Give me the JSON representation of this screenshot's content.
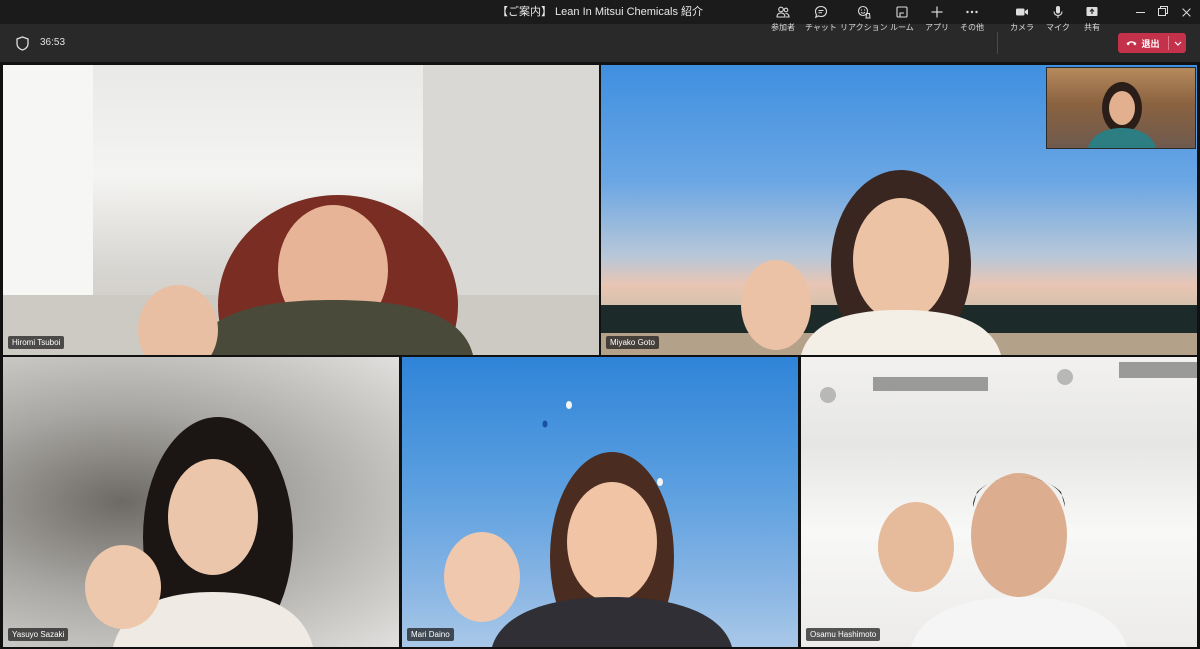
{
  "window": {
    "title": "【ご案内】 Lean In Mitsui Chemicals 紹介"
  },
  "toolbar": {
    "timer": "36:53",
    "buttons": [
      {
        "icon": "people-icon",
        "label": "参加者"
      },
      {
        "icon": "chat-icon",
        "label": "チャット"
      },
      {
        "icon": "reaction-icon",
        "label": "リアクション"
      },
      {
        "icon": "rooms-icon",
        "label": "ルーム"
      },
      {
        "icon": "plus-icon",
        "label": "アプリ"
      },
      {
        "icon": "more-icon",
        "label": "その他"
      },
      {
        "icon": "camera-icon",
        "label": "カメラ"
      },
      {
        "icon": "mic-icon",
        "label": "マイク"
      },
      {
        "icon": "share-icon",
        "label": "共有"
      }
    ],
    "leave_label": "退出",
    "leave_color": "#c4314b"
  },
  "participants": [
    {
      "name": "Hiromi Tsuboi"
    },
    {
      "name": "Miyako Goto"
    },
    {
      "name": "Yasuyo Sazaki"
    },
    {
      "name": "Mari Daino"
    },
    {
      "name": "Osamu Hashimoto"
    }
  ]
}
